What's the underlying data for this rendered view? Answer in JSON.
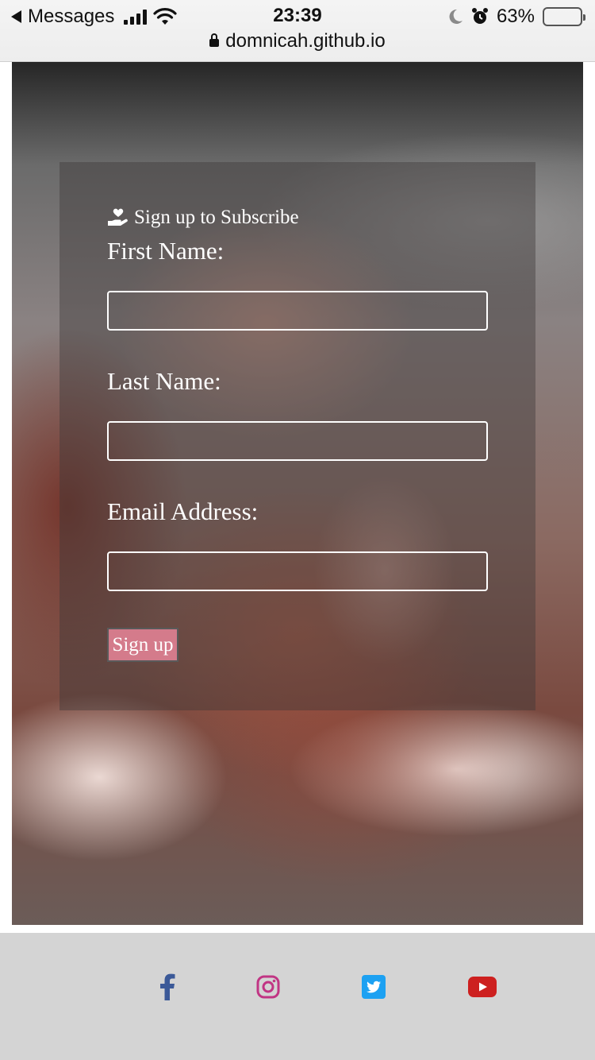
{
  "status_bar": {
    "back_label": "Messages",
    "time": "23:39",
    "battery_percent_text": "63%",
    "battery_level": 0.63,
    "url": "domnicah.github.io"
  },
  "form": {
    "heading": "Sign up to Subscribe",
    "heading_icon": "hand-holding-heart-icon",
    "fields": [
      {
        "label": "First Name:",
        "value": ""
      },
      {
        "label": "Last Name:",
        "value": ""
      },
      {
        "label": "Email Address:",
        "value": ""
      }
    ],
    "submit_label": "Sign up",
    "submit_color": "#d47b8b"
  },
  "footer": {
    "social": [
      {
        "name": "facebook-icon",
        "color": "#3b5998"
      },
      {
        "name": "instagram-icon",
        "color": "#c13584"
      },
      {
        "name": "twitter-icon",
        "color": "#1da1f2"
      },
      {
        "name": "youtube-icon",
        "color": "#cd201f"
      }
    ]
  }
}
